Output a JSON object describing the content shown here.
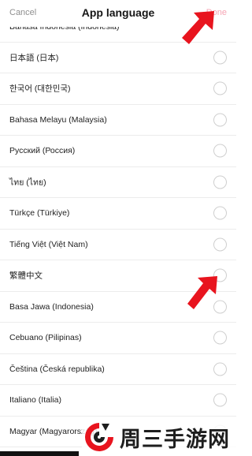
{
  "header": {
    "cancel_label": "Cancel",
    "title": "App language",
    "done_label": "Done"
  },
  "languages": [
    {
      "label": "Bahasa Indonesia (Indonesia)",
      "selected": false
    },
    {
      "label": "日本語 (日本)",
      "selected": false
    },
    {
      "label": "한국어 (대한민국)",
      "selected": false
    },
    {
      "label": "Bahasa Melayu (Malaysia)",
      "selected": false
    },
    {
      "label": "Русский (Россия)",
      "selected": false
    },
    {
      "label": "ไทย (ไทย)",
      "selected": false
    },
    {
      "label": "Türkçe (Türkiye)",
      "selected": false
    },
    {
      "label": "Tiếng Việt (Việt Nam)",
      "selected": false
    },
    {
      "label": "繁體中文",
      "selected": false
    },
    {
      "label": "Basa Jawa (Indonesia)",
      "selected": false
    },
    {
      "label": "Cebuano (Pilipinas)",
      "selected": false
    },
    {
      "label": "Čeština (Česká republika)",
      "selected": false
    },
    {
      "label": "Italiano (Italia)",
      "selected": false
    },
    {
      "label": "Magyar (Magyarország)",
      "selected": false
    }
  ],
  "watermark": {
    "text": "周三手游网"
  },
  "colors": {
    "accent": "#f6a5b4",
    "arrow": "#e8141e"
  }
}
